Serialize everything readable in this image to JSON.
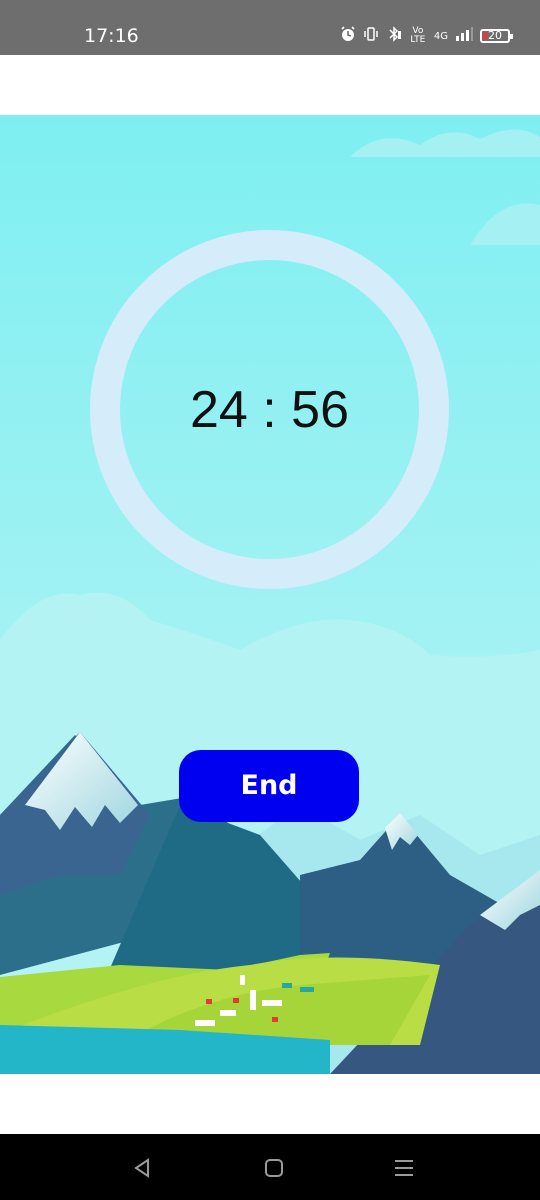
{
  "status_bar": {
    "time": "17:16",
    "network_label": "4G",
    "volte_label": "Vo LTE",
    "battery_level": "20"
  },
  "timer": {
    "display": "24 : 56"
  },
  "actions": {
    "end_label": "End"
  },
  "icons": {
    "alarm": "alarm-icon",
    "vibrate": "vibrate-icon",
    "bluetooth": "bluetooth-icon",
    "signal": "signal-icon",
    "back": "back-icon",
    "home": "home-icon",
    "recents": "recents-icon"
  },
  "colors": {
    "status_bar": "#6e6e6e",
    "sky": "#7ef0f2",
    "ring": "#d5ecfa",
    "end_button": "#0000f0"
  }
}
